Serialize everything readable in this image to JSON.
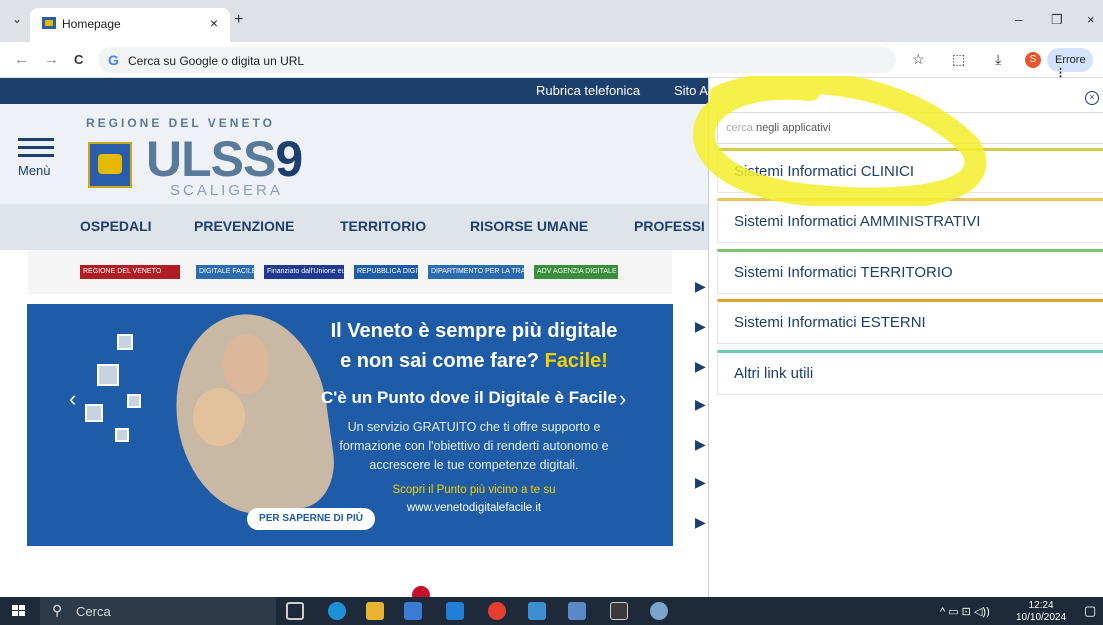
{
  "browser": {
    "tab_title": "Homepage",
    "tab_close": "×",
    "new_tab": "+",
    "tab_dropdown": "⌄",
    "window_controls": {
      "minimize": "–",
      "restore": "❐",
      "close": "×"
    },
    "nav": {
      "back": "←",
      "forward": "→",
      "reload": "C"
    },
    "omnibox_placeholder": "Cerca su Google o digita un URL",
    "omnibox_g": "G",
    "bookmark": "☆",
    "extensions": "⬚",
    "download": "⤓",
    "profile_initial": "S",
    "error_label": "Errore",
    "menu": "⋮"
  },
  "site": {
    "topbar": {
      "rubrica": "Rubrica telefonica",
      "sito": "Sito A"
    },
    "menu_label": "Menù",
    "region": "REGIONE DEL VENETO",
    "logo_ulss": "ULSS",
    "logo_nine": "9",
    "logo_scaligera": "SCALIGERA",
    "nav": [
      "OSPEDALI",
      "PREVENZIONE",
      "TERRITORIO",
      "RISORSE UMANE",
      "PROFESSI"
    ],
    "partner_logos": [
      "REGIONE DEL VENETO",
      "DIGITALE FACILE",
      "Finanziato dall'Unione europea",
      "REPUBBLICA DIGITALE",
      "DIPARTIMENTO PER LA TRASFORMAZIONE DIGITALE",
      "ADV AGENZIA DIGITALE DEL VENETO"
    ],
    "banner": {
      "line1": "Il Veneto è sempre più digitale",
      "line2_pre": "e non sai come fare? ",
      "line2_hl": "Facile!",
      "line3": "C'è un Punto dove il Digitale è Facile",
      "p1": "Un servizio GRATUITO che ti offre supporto e",
      "p2": "formazione con l'obiettivo di renderti autonomo e",
      "p3": "accrescere le tue competenze digitali.",
      "yellow": "Scopri il Punto più vicino a te su",
      "url": "www.venetodigitalefacile.it",
      "button": "PER SAPERNE DI PIÙ",
      "prev": "‹",
      "next": "›"
    },
    "side_arrow": "▶"
  },
  "panel": {
    "close": "×",
    "search_hl": "cerca",
    "search_rest": " negli applicativi",
    "links": [
      {
        "label": "Sistemi Informatici CLINICI",
        "color": "#d9c94a"
      },
      {
        "label": "Sistemi Informatici AMMINISTRATIVI",
        "color": "#e9c36a"
      },
      {
        "label": "Sistemi Informatici TERRITORIO",
        "color": "#7dc46b"
      },
      {
        "label": "Sistemi Informatici ESTERNI",
        "color": "#e0a12e"
      },
      {
        "label": "Altri link utili",
        "color": "#6cc7b8"
      }
    ]
  },
  "taskbar": {
    "search": "Cerca",
    "search_icon": "⚲",
    "time": "12:24",
    "date": "10/10/2024",
    "tray": "^ ▭ ⊡ ◁))",
    "notifications": "▢"
  }
}
